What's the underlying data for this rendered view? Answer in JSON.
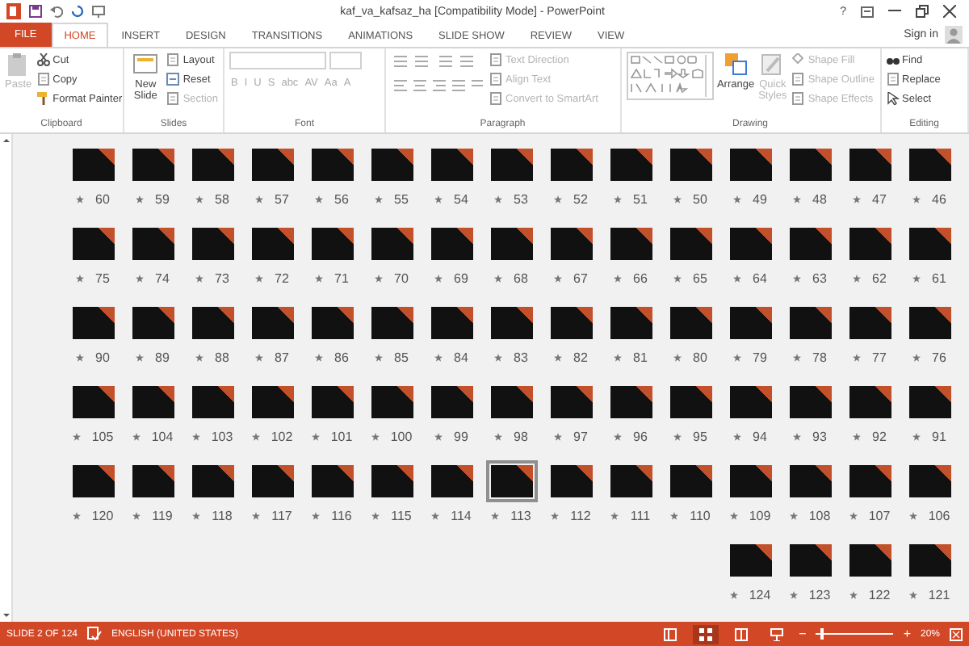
{
  "window": {
    "title": "kaf_va_kafsaz_ha [Compatibility Mode] - PowerPoint",
    "help": "?"
  },
  "tabs": [
    {
      "label": "FILE",
      "kind": "file",
      "selected": false
    },
    {
      "label": "HOME",
      "kind": "tab",
      "selected": true
    },
    {
      "label": "INSERT",
      "kind": "tab",
      "selected": false
    },
    {
      "label": "DESIGN",
      "kind": "tab",
      "selected": false
    },
    {
      "label": "TRANSITIONS",
      "kind": "tab",
      "selected": false
    },
    {
      "label": "ANIMATIONS",
      "kind": "tab",
      "selected": false
    },
    {
      "label": "SLIDE SHOW",
      "kind": "tab",
      "selected": false
    },
    {
      "label": "REVIEW",
      "kind": "tab",
      "selected": false
    },
    {
      "label": "VIEW",
      "kind": "tab",
      "selected": false
    }
  ],
  "sign_in": "Sign in",
  "ribbon": {
    "groups": [
      {
        "kind": "clipboard",
        "label": "Clipboard",
        "large": [
          {
            "label": "Paste",
            "kind": "paste",
            "disabled": true
          }
        ],
        "items": [
          {
            "label": "Cut",
            "kind": "cut",
            "disabled": false
          },
          {
            "label": "Copy",
            "kind": "copy",
            "disabled": false
          },
          {
            "label": "Format Painter",
            "kind": "brush",
            "disabled": false
          }
        ]
      },
      {
        "kind": "slides",
        "label": "Slides",
        "large": [
          {
            "label": "New Slide",
            "kind": "slide",
            "disabled": false
          }
        ],
        "items": [
          {
            "label": "Layout",
            "kind": "layout",
            "disabled": false
          },
          {
            "label": "Reset",
            "kind": "reset",
            "disabled": false
          },
          {
            "label": "Section",
            "kind": "section",
            "disabled": true
          }
        ]
      },
      {
        "kind": "font",
        "label": "Font",
        "buttons": [
          {
            "label": "B",
            "disabled": true
          },
          {
            "label": "I",
            "disabled": true
          },
          {
            "label": "U",
            "disabled": true
          },
          {
            "label": "S",
            "disabled": true
          },
          {
            "label": "abc",
            "disabled": true
          },
          {
            "label": "AV",
            "disabled": true
          },
          {
            "label": "Aa",
            "disabled": true
          },
          {
            "label": "A",
            "disabled": true
          }
        ]
      },
      {
        "kind": "paragraph",
        "label": "Paragraph",
        "items": [
          {
            "label": "Text Direction",
            "kind": "textdir",
            "disabled": true
          },
          {
            "label": "Align Text",
            "kind": "align",
            "disabled": true
          },
          {
            "label": "Convert to SmartArt",
            "kind": "smartart",
            "disabled": true
          }
        ]
      },
      {
        "kind": "drawing",
        "label": "Drawing",
        "large": [
          {
            "label": "Arrange",
            "kind": "arrange",
            "disabled": false
          },
          {
            "label": "Quick Styles",
            "kind": "styles",
            "disabled": true
          }
        ],
        "items": [
          {
            "label": "Shape Fill",
            "kind": "fill",
            "disabled": true
          },
          {
            "label": "Shape Outline",
            "kind": "outline",
            "disabled": true
          },
          {
            "label": "Shape Effects",
            "kind": "effects",
            "disabled": true
          }
        ]
      },
      {
        "kind": "editing",
        "label": "Editing",
        "items": [
          {
            "label": "Find",
            "kind": "find",
            "disabled": false
          },
          {
            "label": "Replace",
            "kind": "replace",
            "disabled": false
          },
          {
            "label": "Select",
            "kind": "select",
            "disabled": false
          }
        ]
      }
    ]
  },
  "sorter": {
    "rows": [
      {
        "slides": [
          {
            "number": "60",
            "selected": false
          },
          {
            "number": "59",
            "selected": false
          },
          {
            "number": "58",
            "selected": false
          },
          {
            "number": "57",
            "selected": false
          },
          {
            "number": "56",
            "selected": false
          },
          {
            "number": "55",
            "selected": false
          },
          {
            "number": "54",
            "selected": false
          },
          {
            "number": "53",
            "selected": false
          },
          {
            "number": "52",
            "selected": false
          },
          {
            "number": "51",
            "selected": false
          },
          {
            "number": "50",
            "selected": false
          },
          {
            "number": "49",
            "selected": false
          },
          {
            "number": "48",
            "selected": false
          },
          {
            "number": "47",
            "selected": false
          },
          {
            "number": "46",
            "selected": false
          }
        ]
      },
      {
        "slides": [
          {
            "number": "75",
            "selected": false
          },
          {
            "number": "74",
            "selected": false
          },
          {
            "number": "73",
            "selected": false
          },
          {
            "number": "72",
            "selected": false
          },
          {
            "number": "71",
            "selected": false
          },
          {
            "number": "70",
            "selected": false
          },
          {
            "number": "69",
            "selected": false
          },
          {
            "number": "68",
            "selected": false
          },
          {
            "number": "67",
            "selected": false
          },
          {
            "number": "66",
            "selected": false
          },
          {
            "number": "65",
            "selected": false
          },
          {
            "number": "64",
            "selected": false
          },
          {
            "number": "63",
            "selected": false
          },
          {
            "number": "62",
            "selected": false
          },
          {
            "number": "61",
            "selected": false
          }
        ]
      },
      {
        "slides": [
          {
            "number": "90",
            "selected": false
          },
          {
            "number": "89",
            "selected": false
          },
          {
            "number": "88",
            "selected": false
          },
          {
            "number": "87",
            "selected": false
          },
          {
            "number": "86",
            "selected": false
          },
          {
            "number": "85",
            "selected": false
          },
          {
            "number": "84",
            "selected": false
          },
          {
            "number": "83",
            "selected": false
          },
          {
            "number": "82",
            "selected": false
          },
          {
            "number": "81",
            "selected": false
          },
          {
            "number": "80",
            "selected": false
          },
          {
            "number": "79",
            "selected": false
          },
          {
            "number": "78",
            "selected": false
          },
          {
            "number": "77",
            "selected": false
          },
          {
            "number": "76",
            "selected": false
          }
        ]
      },
      {
        "slides": [
          {
            "number": "105",
            "selected": false
          },
          {
            "number": "104",
            "selected": false
          },
          {
            "number": "103",
            "selected": false
          },
          {
            "number": "102",
            "selected": false
          },
          {
            "number": "101",
            "selected": false
          },
          {
            "number": "100",
            "selected": false
          },
          {
            "number": "99",
            "selected": false
          },
          {
            "number": "98",
            "selected": false
          },
          {
            "number": "97",
            "selected": false
          },
          {
            "number": "96",
            "selected": false
          },
          {
            "number": "95",
            "selected": false
          },
          {
            "number": "94",
            "selected": false
          },
          {
            "number": "93",
            "selected": false
          },
          {
            "number": "92",
            "selected": false
          },
          {
            "number": "91",
            "selected": false
          }
        ]
      },
      {
        "slides": [
          {
            "number": "120",
            "selected": false
          },
          {
            "number": "119",
            "selected": false
          },
          {
            "number": "118",
            "selected": false
          },
          {
            "number": "117",
            "selected": false
          },
          {
            "number": "116",
            "selected": false
          },
          {
            "number": "115",
            "selected": false
          },
          {
            "number": "114",
            "selected": false
          },
          {
            "number": "113",
            "selected": true
          },
          {
            "number": "112",
            "selected": false
          },
          {
            "number": "111",
            "selected": false
          },
          {
            "number": "110",
            "selected": false
          },
          {
            "number": "109",
            "selected": false
          },
          {
            "number": "108",
            "selected": false
          },
          {
            "number": "107",
            "selected": false
          },
          {
            "number": "106",
            "selected": false
          }
        ]
      },
      {
        "slides": [
          {
            "number": "124",
            "selected": false
          },
          {
            "number": "123",
            "selected": false
          },
          {
            "number": "122",
            "selected": false
          },
          {
            "number": "121",
            "selected": false
          }
        ]
      }
    ]
  },
  "status_bar": {
    "slide_info": "SLIDE 2 OF 124",
    "language": "ENGLISH (UNITED STATES)",
    "views": [
      {
        "kind": "normal",
        "selected": false
      },
      {
        "kind": "sorter",
        "selected": true
      },
      {
        "kind": "reading",
        "selected": false
      },
      {
        "kind": "show",
        "selected": false
      }
    ],
    "zoom": {
      "out": "−",
      "in": "+",
      "level": 0.06,
      "reading": "20%"
    }
  }
}
